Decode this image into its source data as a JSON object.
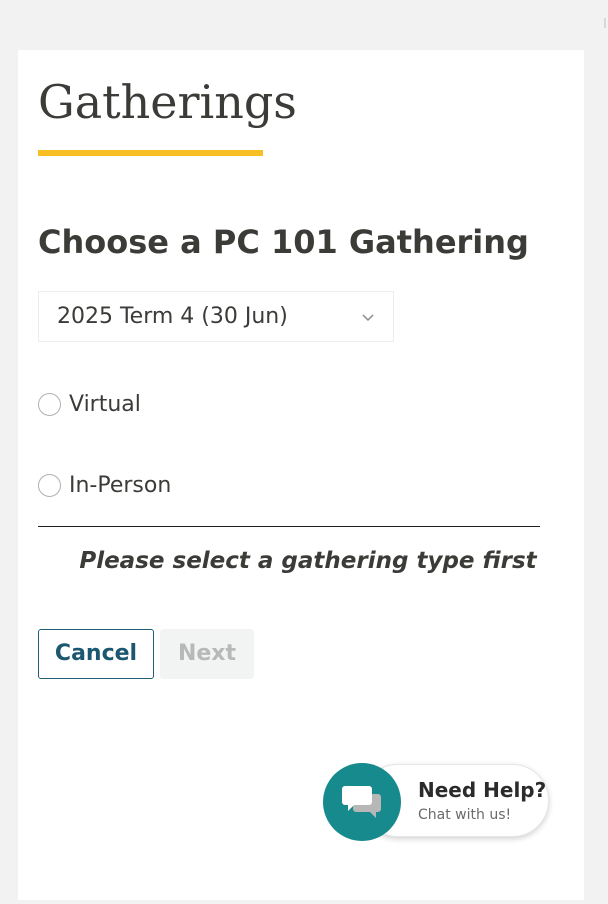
{
  "page": {
    "title": "Gatherings",
    "accent_color": "#f7bf23"
  },
  "form": {
    "heading": "Choose a PC 101 Gathering",
    "term_select": {
      "selected_value": "2025 Term 4 (30 Jun)",
      "icon": "chevron-down-icon"
    },
    "gathering_types": [
      {
        "label": "Virtual",
        "checked": false
      },
      {
        "label": "In-Person",
        "checked": false
      }
    ],
    "hint": "Please select a gathering type first",
    "buttons": {
      "cancel_label": "Cancel",
      "next_label": "Next",
      "next_enabled": false
    }
  },
  "help_widget": {
    "title": "Need Help?",
    "subtitle": "Chat with us!",
    "icon": "chat-bubbles-icon",
    "color": "#168a8c"
  }
}
